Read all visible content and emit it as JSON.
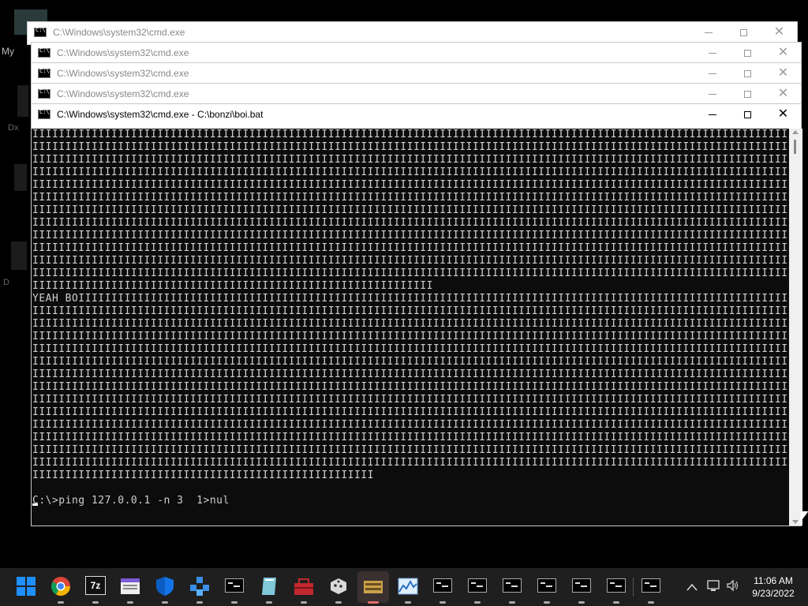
{
  "desktop": {
    "label_my": "My",
    "label_dx": "Dx",
    "label_d": "D"
  },
  "windows": [
    {
      "title": "C:\\Windows\\system32\\cmd.exe"
    },
    {
      "title": "C:\\Windows\\system32\\cmd.exe"
    },
    {
      "title": "C:\\Windows\\system32\\cmd.exe"
    },
    {
      "title": "C:\\Windows\\system32\\cmd.exe"
    },
    {
      "title": "C:\\Windows\\system32\\cmd.exe - C:\\bonzi\\boi.bat"
    }
  ],
  "console": {
    "lines_block1": [
      "IIIIIIIIIIIIIIIIIIIIIIIIIIIIIIIIIIIIIIIIIIIIIIIIIIIIIIIIIIIIIIIIIIIIIIIIIIIIIIIIIIIIIIIIIIIIIIIIIIIIIIIIIIIIIIIIIIIIIIII",
      "IIIIIIIIIIIIIIIIIIIIIIIIIIIIIIIIIIIIIIIIIIIIIIIIIIIIIIIIIIIIIIIIIIIIIIIIIIIIIIIIIIIIIIIIIIIIIIIIIIIIIIIIIIIIIIIIIIIIIIII",
      "IIIIIIIIIIIIIIIIIIIIIIIIIIIIIIIIIIIIIIIIIIIIIIIIIIIIIIIIIIIIIIIIIIIIIIIIIIIIIIIIIIIIIIIIIIIIIIIIIIIIIIIIIIIIIIIIIIIIIIII",
      "IIIIIIIIIIIIIIIIIIIIIIIIIIIIIIIIIIIIIIIIIIIIIIIIIIIIIIIIIIIIIIIIIIIIIIIIIIIIIIIIIIIIIIIIIIIIIIIIIIIIIIIIIIIIIIIIIIIIIIII",
      "IIIIIIIIIIIIIIIIIIIIIIIIIIIIIIIIIIIIIIIIIIIIIIIIIIIIIIIIIIIIIIIIIIIIIIIIIIIIIIIIIIIIIIIIIIIIIIIIIIIIIIIIIIIIIIIIIIIIIIII",
      "IIIIIIIIIIIIIIIIIIIIIIIIIIIIIIIIIIIIIIIIIIIIIIIIIIIIIIIIIIIIIIIIIIIIIIIIIIIIIIIIIIIIIIIIIIIIIIIIIIIIIIIIIIIIIIIIIIIIIIII",
      "IIIIIIIIIIIIIIIIIIIIIIIIIIIIIIIIIIIIIIIIIIIIIIIIIIIIIIIIIIIIIIIIIIIIIIIIIIIIIIIIIIIIIIIIIIIIIIIIIIIIIIIIIIIIIIIIIIIIIIII",
      "IIIIIIIIIIIIIIIIIIIIIIIIIIIIIIIIIIIIIIIIIIIIIIIIIIIIIIIIIIIIIIIIIIIIIIIIIIIIIIIIIIIIIIIIIIIIIIIIIIIIIIIIIIIIIIIIIIIIIIII",
      "IIIIIIIIIIIIIIIIIIIIIIIIIIIIIIIIIIIIIIIIIIIIIIIIIIIIIIIIIIIIIIIIIIIIIIIIIIIIIIIIIIIIIIIIIIIIIIIIIIIIIIIIIIIIIIIIIIIIIIII",
      "IIIIIIIIIIIIIIIIIIIIIIIIIIIIIIIIIIIIIIIIIIIIIIIIIIIIIIIIIIIIIIIIIIIIIIIIIIIIIIIIIIIIIIIIIIIIIIIIIIIIIIIIIIIIIIIIIIIIIIII",
      "IIIIIIIIIIIIIIIIIIIIIIIIIIIIIIIIIIIIIIIIIIIIIIIIIIIIIIIIIIIIIIIIIIIIIIIIIIIIIIIIIIIIIIIIIIIIIIIIIIIIIIIIIIIIIIIIIIIIIIII",
      "IIIIIIIIIIIIIIIIIIIIIIIIIIIIIIIIIIIIIIIIIIIIIIIIIIIIIIIIIIIIIIIIIIIIIIIIIIIIIIIIIIIIIIIIIIIIIIIIIIIIIIIIIIIIIIIIIIIIIIII",
      "IIIIIIIIIIIIIIIIIIIIIIIIIIIIIIIIIIIIIIIIIIIIIIIIIIIIIIIIIIIII"
    ],
    "yeah_line": "YEAH BOIIIIIIIIIIIIIIIIIIIIIIIIIIIIIIIIIIIIIIIIIIIIIIIIIIIIIIIIIIIIIIIIIIIIIIIIIIIIIIIIIIIIIIIIIIIIIIIIIIIIIIIIIIIIIIIIII",
    "lines_block2": [
      "IIIIIIIIIIIIIIIIIIIIIIIIIIIIIIIIIIIIIIIIIIIIIIIIIIIIIIIIIIIIIIIIIIIIIIIIIIIIIIIIIIIIIIIIIIIIIIIIIIIIIIIIIIIIIIIIIIIIIIII",
      "IIIIIIIIIIIIIIIIIIIIIIIIIIIIIIIIIIIIIIIIIIIIIIIIIIIIIIIIIIIIIIIIIIIIIIIIIIIIIIIIIIIIIIIIIIIIIIIIIIIIIIIIIIIIIIIIIIIIIIII",
      "IIIIIIIIIIIIIIIIIIIIIIIIIIIIIIIIIIIIIIIIIIIIIIIIIIIIIIIIIIIIIIIIIIIIIIIIIIIIIIIIIIIIIIIIIIIIIIIIIIIIIIIIIIIIIIIIIIIIIIII",
      "IIIIIIIIIIIIIIIIIIIIIIIIIIIIIIIIIIIIIIIIIIIIIIIIIIIIIIIIIIIIIIIIIIIIIIIIIIIIIIIIIIIIIIIIIIIIIIIIIIIIIIIIIIIIIIIIIIIIIIII",
      "IIIIIIIIIIIIIIIIIIIIIIIIIIIIIIIIIIIIIIIIIIIIIIIIIIIIIIIIIIIIIIIIIIIIIIIIIIIIIIIIIIIIIIIIIIIIIIIIIIIIIIIIIIIIIIIIIIIIIIII",
      "IIIIIIIIIIIIIIIIIIIIIIIIIIIIIIIIIIIIIIIIIIIIIIIIIIIIIIIIIIIIIIIIIIIIIIIIIIIIIIIIIIIIIIIIIIIIIIIIIIIIIIIIIIIIIIIIIIIIIIII",
      "IIIIIIIIIIIIIIIIIIIIIIIIIIIIIIIIIIIIIIIIIIIIIIIIIIIIIIIIIIIIIIIIIIIIIIIIIIIIIIIIIIIIIIIIIIIIIIIIIIIIIIIIIIIIIIIIIIIIIIII",
      "IIIIIIIIIIIIIIIIIIIIIIIIIIIIIIIIIIIIIIIIIIIIIIIIIIIIIIIIIIIIIIIIIIIIIIIIIIIIIIIIIIIIIIIIIIIIIIIIIIIIIIIIIIIIIIIIIIIIIIII",
      "IIIIIIIIIIIIIIIIIIIIIIIIIIIIIIIIIIIIIIIIIIIIIIIIIIIIIIIIIIIIIIIIIIIIIIIIIIIIIIIIIIIIIIIIIIIIIIIIIIIIIIIIIIIIIIIIIIIIIIII",
      "IIIIIIIIIIIIIIIIIIIIIIIIIIIIIIIIIIIIIIIIIIIIIIIIIIIIIIIIIIIIIIIIIIIIIIIIIIIIIIIIIIIIIIIIIIIIIIIIIIIIIIIIIIIIIIIIIIIIIIII",
      "IIIIIIIIIIIIIIIIIIIIIIIIIIIIIIIIIIIIIIIIIIIIIIIIIIIIIIIIIIIIIIIIIIIIIIIIIIIIIIIIIIIIIIIIIIIIIIIIIIIIIIIIIIIIIIIIIIIIIIII",
      "IIIIIIIIIIIIIIIIIIIIIIIIIIIIIIIIIIIIIIIIIIIIIIIIIIIIIIIIIIIIIIIIIIIIIIIIIIIIIIIIIIIIIIIIIIIIIIIIIIIIIIIIIIIIIIIIIIIIIIII",
      "IIIIIIIIIIIIIIIIIIIIIIIIIIIIIIIIIIIIIIIIIIIIIIIIIIIIIIIIIIIIIIIIIIIIIIIIIIIIIIIIIIIIIIIIIIIIIIIIIIIIIIIIIIIIIIIIIIIIIIII",
      "IIIIIIIIIIIIIIIIIIIIIIIIIIIIIIIIIIIIIIIIIIIIIIIIIIII"
    ],
    "prompt": "C:\\>ping 127.0.0.1 -n 3  1>nul"
  },
  "taskbar": {
    "apps": [
      {
        "name": "start-icon"
      },
      {
        "name": "chrome-icon"
      },
      {
        "name": "7zip-icon",
        "label": "7z"
      },
      {
        "name": "file-explorer-icon"
      },
      {
        "name": "windows-security-icon"
      },
      {
        "name": "network-app-icon"
      },
      {
        "name": "cmd-icon"
      },
      {
        "name": "notepad-icon"
      },
      {
        "name": "toolbox-icon"
      },
      {
        "name": "dice-icon"
      },
      {
        "name": "bonzi-app-icon"
      },
      {
        "name": "resource-monitor-icon"
      },
      {
        "name": "cmd-icon"
      },
      {
        "name": "cmd-icon"
      },
      {
        "name": "cmd-icon"
      },
      {
        "name": "cmd-icon"
      },
      {
        "name": "cmd-icon"
      },
      {
        "name": "cmd-icon"
      },
      {
        "name": "cmd-icon"
      }
    ],
    "tray_chevron": "^",
    "time": "11:06 AM",
    "date": "9/23/2022"
  },
  "colors": {
    "taskbar_bg": "#1f1f1f",
    "console_bg": "#0c0c0c",
    "console_text": "#cfcfcf",
    "accent_start": "#1e90ff"
  }
}
